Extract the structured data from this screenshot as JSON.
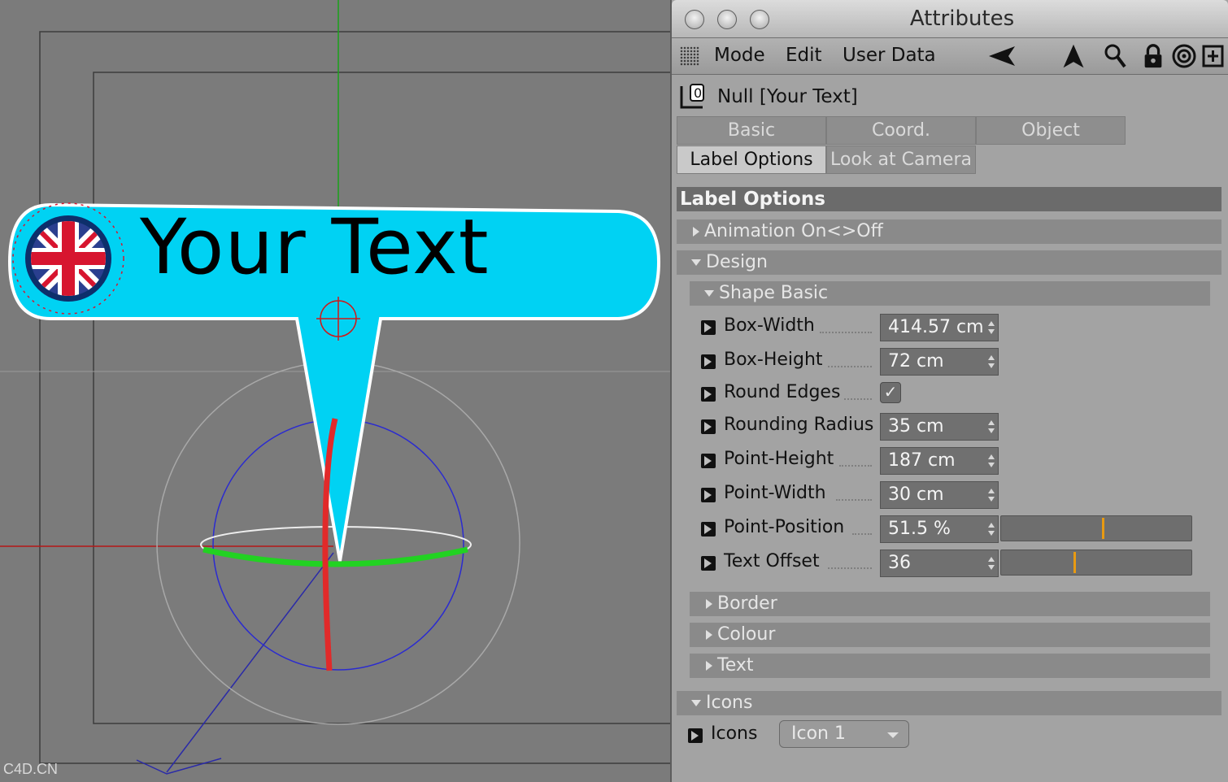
{
  "viewport": {
    "label_text": "Your Text",
    "watermark": "C4D.CN"
  },
  "panel": {
    "title": "Attributes",
    "menu": [
      "Mode",
      "Edit",
      "User Data"
    ],
    "object_name": "Null [Your Text]",
    "tabs": [
      "Basic",
      "Coord.",
      "Object",
      "Label Options",
      "Look at Camera"
    ],
    "active_tab": "Label Options",
    "section_title": "Label Options",
    "groups": {
      "animation": "Animation On<>Off",
      "design": "Design",
      "shape_basic": "Shape Basic",
      "border": "Border",
      "colour": "Colour",
      "text": "Text",
      "icons": "Icons"
    },
    "params": {
      "box_width": {
        "label": "Box-Width",
        "value": "414.57 cm"
      },
      "box_height": {
        "label": "Box-Height",
        "value": "72 cm"
      },
      "round_edges": {
        "label": "Round Edges",
        "checked": true,
        "mark": "✓"
      },
      "rounding_radius": {
        "label": "Rounding Radius",
        "value": "35 cm"
      },
      "point_height": {
        "label": "Point-Height",
        "value": "187 cm"
      },
      "point_width": {
        "label": "Point-Width",
        "value": "30 cm"
      },
      "point_position": {
        "label": "Point-Position",
        "value": "51.5 %",
        "slider_fraction": 0.53
      },
      "text_offset": {
        "label": "Text Offset",
        "value": "36",
        "slider_fraction": 0.38
      }
    },
    "icons_param": {
      "label": "Icons",
      "value": "Icon 1"
    }
  },
  "colors": {
    "label_fill": "#00d2f3",
    "panel_bg": "#a3a3a3",
    "section_bg": "#6b6b6b",
    "slider_knob": "#e89a12"
  }
}
